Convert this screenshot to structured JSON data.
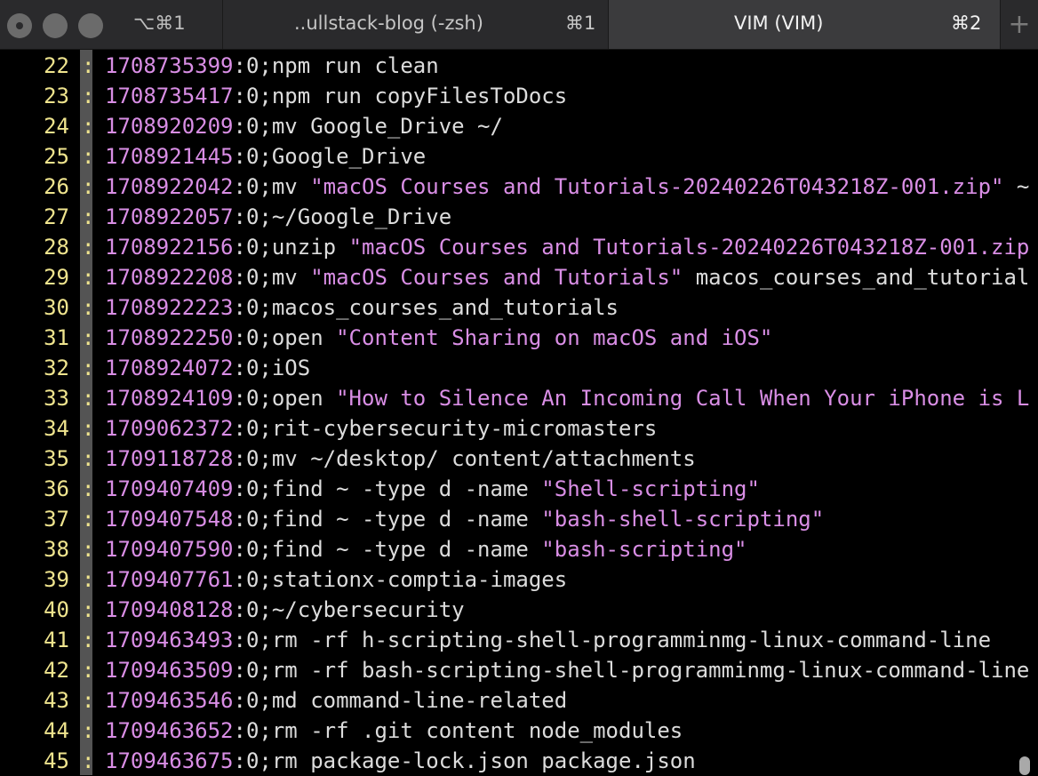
{
  "window": {
    "tabs": [
      {
        "label": "",
        "shortcut": "⌥⌘1"
      },
      {
        "label": "..ullstack-blog (-zsh)",
        "shortcut": "⌘1"
      },
      {
        "label": "VIM (VIM)",
        "shortcut": "⌘2"
      }
    ],
    "new_tab_symbol": "+"
  },
  "editor": {
    "lines": [
      {
        "num": "22",
        "marker": ":",
        "ts": "1708735399",
        "sep": ":0;",
        "cmd": "npm run clean",
        "str": "",
        "rest": ""
      },
      {
        "num": "23",
        "marker": ":",
        "ts": "1708735417",
        "sep": ":0;",
        "cmd": "npm run copyFilesToDocs",
        "str": "",
        "rest": ""
      },
      {
        "num": "24",
        "marker": ":",
        "ts": "1708920209",
        "sep": ":0;",
        "cmd": "mv Google_Drive ~/",
        "str": "",
        "rest": ""
      },
      {
        "num": "25",
        "marker": ":",
        "ts": "1708921445",
        "sep": ":0;",
        "cmd": "Google_Drive",
        "str": "",
        "rest": ""
      },
      {
        "num": "26",
        "marker": ":",
        "ts": "1708922042",
        "sep": ":0;",
        "cmd": "mv ",
        "str": "\"macOS Courses and Tutorials-20240226T043218Z-001.zip\"",
        "rest": " ~"
      },
      {
        "num": "27",
        "marker": ":",
        "ts": "1708922057",
        "sep": ":0;",
        "cmd": "~/Google_Drive",
        "str": "",
        "rest": ""
      },
      {
        "num": "28",
        "marker": ":",
        "ts": "1708922156",
        "sep": ":0;",
        "cmd": "unzip ",
        "str": "\"macOS Courses and Tutorials-20240226T043218Z-001.zip",
        "rest": ""
      },
      {
        "num": "29",
        "marker": ":",
        "ts": "1708922208",
        "sep": ":0;",
        "cmd": "mv ",
        "str": "\"macOS Courses and Tutorials\"",
        "rest": " macos_courses_and_tutorial"
      },
      {
        "num": "30",
        "marker": ":",
        "ts": "1708922223",
        "sep": ":0;",
        "cmd": "macos_courses_and_tutorials",
        "str": "",
        "rest": ""
      },
      {
        "num": "31",
        "marker": ":",
        "ts": "1708922250",
        "sep": ":0;",
        "cmd": "open ",
        "str": "\"Content Sharing on macOS and iOS\"",
        "rest": ""
      },
      {
        "num": "32",
        "marker": ":",
        "ts": "1708924072",
        "sep": ":0;",
        "cmd": "iOS",
        "str": "",
        "rest": ""
      },
      {
        "num": "33",
        "marker": ":",
        "ts": "1708924109",
        "sep": ":0;",
        "cmd": "open ",
        "str": "\"How to Silence An Incoming Call When Your iPhone is L",
        "rest": ""
      },
      {
        "num": "34",
        "marker": ":",
        "ts": "1709062372",
        "sep": ":0;",
        "cmd": "rit-cybersecurity-micromasters",
        "str": "",
        "rest": ""
      },
      {
        "num": "35",
        "marker": ":",
        "ts": "1709118728",
        "sep": ":0;",
        "cmd": "mv ~/desktop/ content/attachments",
        "str": "",
        "rest": ""
      },
      {
        "num": "36",
        "marker": ":",
        "ts": "1709407409",
        "sep": ":0;",
        "cmd": "find ~ -type d -name ",
        "str": "\"Shell-scripting\"",
        "rest": ""
      },
      {
        "num": "37",
        "marker": ":",
        "ts": "1709407548",
        "sep": ":0;",
        "cmd": "find ~ -type d -name ",
        "str": "\"bash-shell-scripting\"",
        "rest": ""
      },
      {
        "num": "38",
        "marker": ":",
        "ts": "1709407590",
        "sep": ":0;",
        "cmd": "find ~ -type d -name ",
        "str": "\"bash-scripting\"",
        "rest": ""
      },
      {
        "num": "39",
        "marker": ":",
        "ts": "1709407761",
        "sep": ":0;",
        "cmd": "stationx-comptia-images",
        "str": "",
        "rest": ""
      },
      {
        "num": "40",
        "marker": ":",
        "ts": "1709408128",
        "sep": ":0;",
        "cmd": "~/cybersecurity",
        "str": "",
        "rest": ""
      },
      {
        "num": "41",
        "marker": ":",
        "ts": "1709463493",
        "sep": ":0;",
        "cmd": "rm -rf h-scripting-shell-programminmg-linux-command-line",
        "str": "",
        "rest": ""
      },
      {
        "num": "42",
        "marker": ":",
        "ts": "1709463509",
        "sep": ":0;",
        "cmd": "rm -rf bash-scripting-shell-programminmg-linux-command-line",
        "str": "",
        "rest": ""
      },
      {
        "num": "43",
        "marker": ":",
        "ts": "1709463546",
        "sep": ":0;",
        "cmd": "md command-line-related",
        "str": "",
        "rest": ""
      },
      {
        "num": "44",
        "marker": ":",
        "ts": "1709463652",
        "sep": ":0;",
        "cmd": "rm -rf .git content node_modules",
        "str": "",
        "rest": ""
      },
      {
        "num": "45",
        "marker": ":",
        "ts": "1709463675",
        "sep": ":0;",
        "cmd": "rm package-lock.json package.json",
        "str": "",
        "rest": ""
      }
    ]
  }
}
